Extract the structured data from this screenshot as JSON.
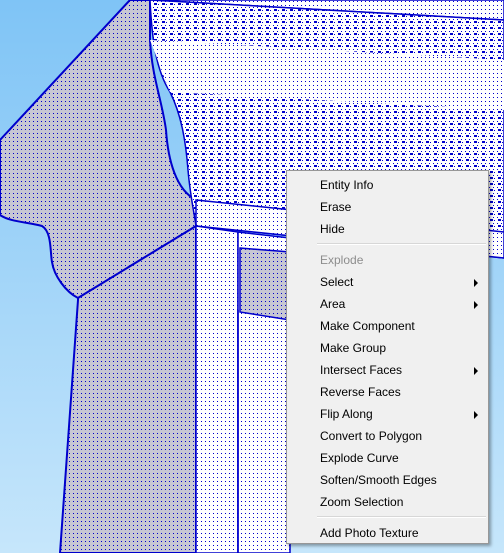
{
  "viewport": {
    "sky_color_top": "#7fc4f6",
    "sky_color_bottom": "#c6e6fb",
    "edge_color": "#0000cc",
    "face_color": "#ffffff",
    "shaded_face_color": "#c7c7d3",
    "selection_dot_color": "#0000cc"
  },
  "context_menu": {
    "groups": [
      {
        "items": [
          {
            "label": "Entity Info",
            "enabled": true,
            "has_submenu": false
          },
          {
            "label": "Erase",
            "enabled": true,
            "has_submenu": false
          },
          {
            "label": "Hide",
            "enabled": true,
            "has_submenu": false
          }
        ]
      },
      {
        "items": [
          {
            "label": "Explode",
            "enabled": false,
            "has_submenu": false
          },
          {
            "label": "Select",
            "enabled": true,
            "has_submenu": true
          },
          {
            "label": "Area",
            "enabled": true,
            "has_submenu": true
          },
          {
            "label": "Make Component",
            "enabled": true,
            "has_submenu": false
          },
          {
            "label": "Make Group",
            "enabled": true,
            "has_submenu": false
          },
          {
            "label": "Intersect Faces",
            "enabled": true,
            "has_submenu": true
          },
          {
            "label": "Reverse Faces",
            "enabled": true,
            "has_submenu": false
          },
          {
            "label": "Flip Along",
            "enabled": true,
            "has_submenu": true
          },
          {
            "label": "Convert to Polygon",
            "enabled": true,
            "has_submenu": false
          },
          {
            "label": "Explode Curve",
            "enabled": true,
            "has_submenu": false
          },
          {
            "label": "Soften/Smooth Edges",
            "enabled": true,
            "has_submenu": false
          },
          {
            "label": "Zoom Selection",
            "enabled": true,
            "has_submenu": false
          }
        ]
      },
      {
        "items": [
          {
            "label": "Add Photo Texture",
            "enabled": true,
            "has_submenu": false
          }
        ]
      }
    ]
  }
}
